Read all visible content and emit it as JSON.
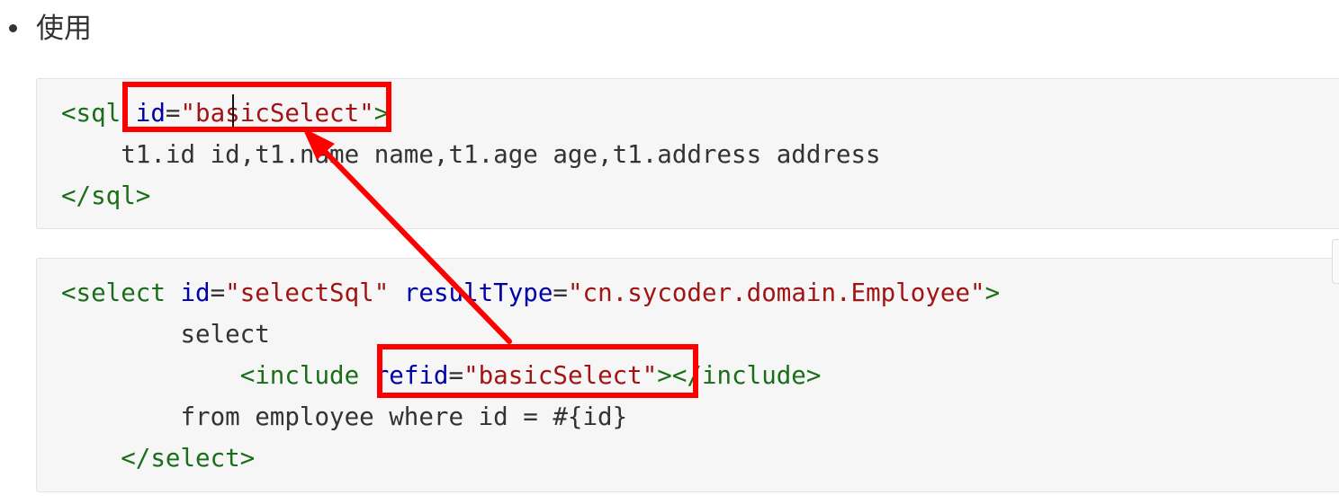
{
  "bullet": {
    "text": "使用"
  },
  "block1": {
    "line1": {
      "open": "<sql",
      "attr": "id",
      "eq": "=",
      "value": "\"basicSelect\"",
      "close": ">"
    },
    "line2": "t1.id id,t1.name name,t1.age age,t1.address address",
    "line3": "</sql>"
  },
  "block2": {
    "line1": {
      "open": "<select",
      "attr1": "id",
      "eq1": "=",
      "value1": "\"selectSql\"",
      "attr2": "resultType",
      "eq2": "=",
      "value2": "\"cn.sycoder.domain.Employee\"",
      "close": ">"
    },
    "line2": "select",
    "line3": {
      "open": "<include",
      "attr": "refid",
      "eq": "=",
      "value": "\"basicSelect\"",
      "close": ">",
      "end": "</include>"
    },
    "line4": "from employee where id = #{id}",
    "line5": "</select>"
  },
  "colors": {
    "tag": "#1a6e1a",
    "attribute": "#0000aa",
    "string": "#a11414",
    "annotation": "#ff0000",
    "code_background": "#f6f6f6"
  }
}
